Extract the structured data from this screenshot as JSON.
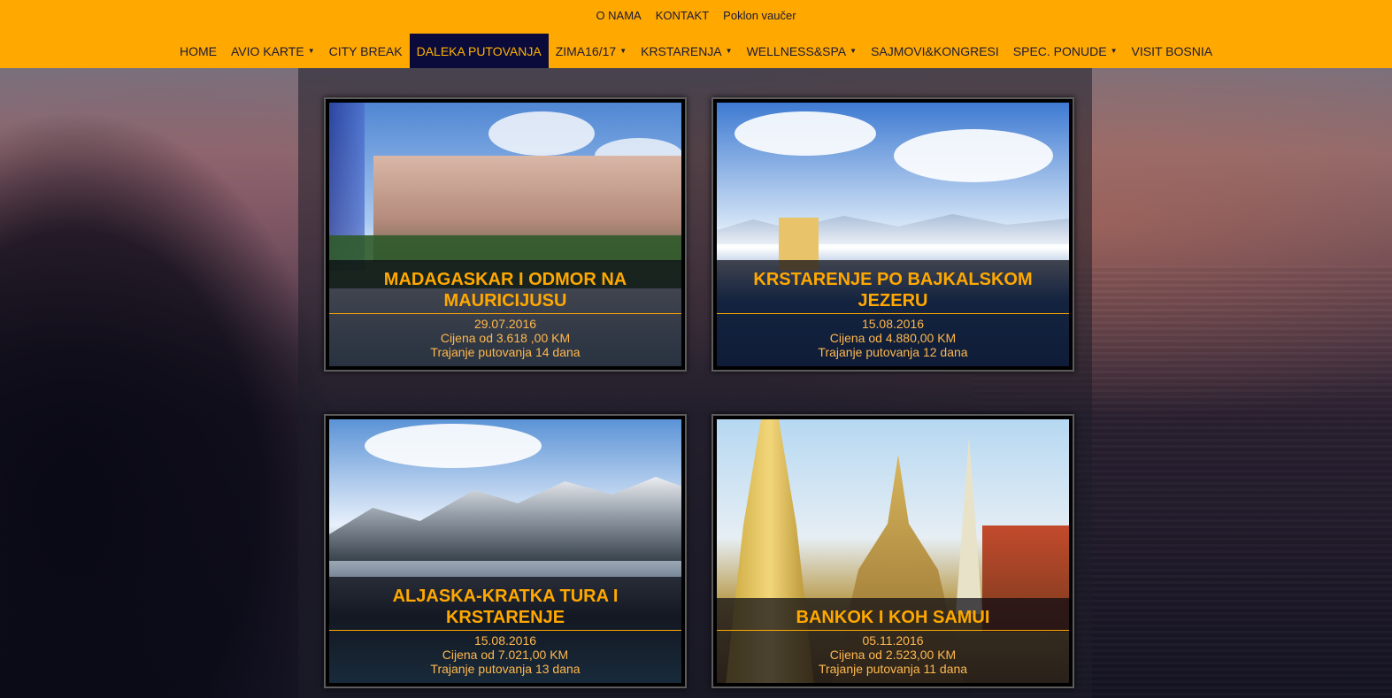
{
  "top_nav": [
    "O NAMA",
    "KONTAKT",
    "Poklon vaučer"
  ],
  "main_nav": [
    {
      "label": "HOME",
      "dropdown": false,
      "active": false
    },
    {
      "label": "AVIO KARTE",
      "dropdown": true,
      "active": false
    },
    {
      "label": "CITY BREAK",
      "dropdown": false,
      "active": false
    },
    {
      "label": "DALEKA PUTOVANJA",
      "dropdown": false,
      "active": true
    },
    {
      "label": "ZIMA16/17",
      "dropdown": true,
      "active": false
    },
    {
      "label": "KRSTARENJA",
      "dropdown": true,
      "active": false
    },
    {
      "label": "WELLNESS&SPA",
      "dropdown": true,
      "active": false
    },
    {
      "label": "SAJMOVI&KONGRESI",
      "dropdown": false,
      "active": false
    },
    {
      "label": "SPEC. PONUDE",
      "dropdown": true,
      "active": false
    },
    {
      "label": "VISIT BOSNIA",
      "dropdown": false,
      "active": false
    }
  ],
  "caret_glyph": "▼",
  "colors": {
    "header": "#ffa800",
    "active_nav": "#0b0b3b",
    "accent": "#ffa800"
  },
  "offers": [
    {
      "title": "MADAGASKAR I ODMOR NA MAURICIJUSU",
      "date": "29.07.2016",
      "price": "Cijena od 3.618 ,00 KM",
      "duration": "Trajanje putovanja 14 dana",
      "image": "resort-building-photo"
    },
    {
      "title": "KRSTARENJE PO BAJKALSKOM JEZERU",
      "date": "15.08.2016",
      "price": "Cijena od 4.880,00 KM",
      "duration": "Trajanje putovanja 12 dana",
      "image": "lake-mountains-photo"
    },
    {
      "title": "ALJASKA-KRATKA TURA I KRSTARENJE",
      "date": "15.08.2016",
      "price": "Cijena od 7.021,00 KM",
      "duration": "Trajanje putovanja 13 dana",
      "image": "glacier-mountains-photo"
    },
    {
      "title": "BANKOK I KOH SAMUI",
      "date": "05.11.2016",
      "price": "Cijena od 2.523,00 KM",
      "duration": "Trajanje putovanja 11 dana",
      "image": "thai-temple-photo"
    }
  ]
}
